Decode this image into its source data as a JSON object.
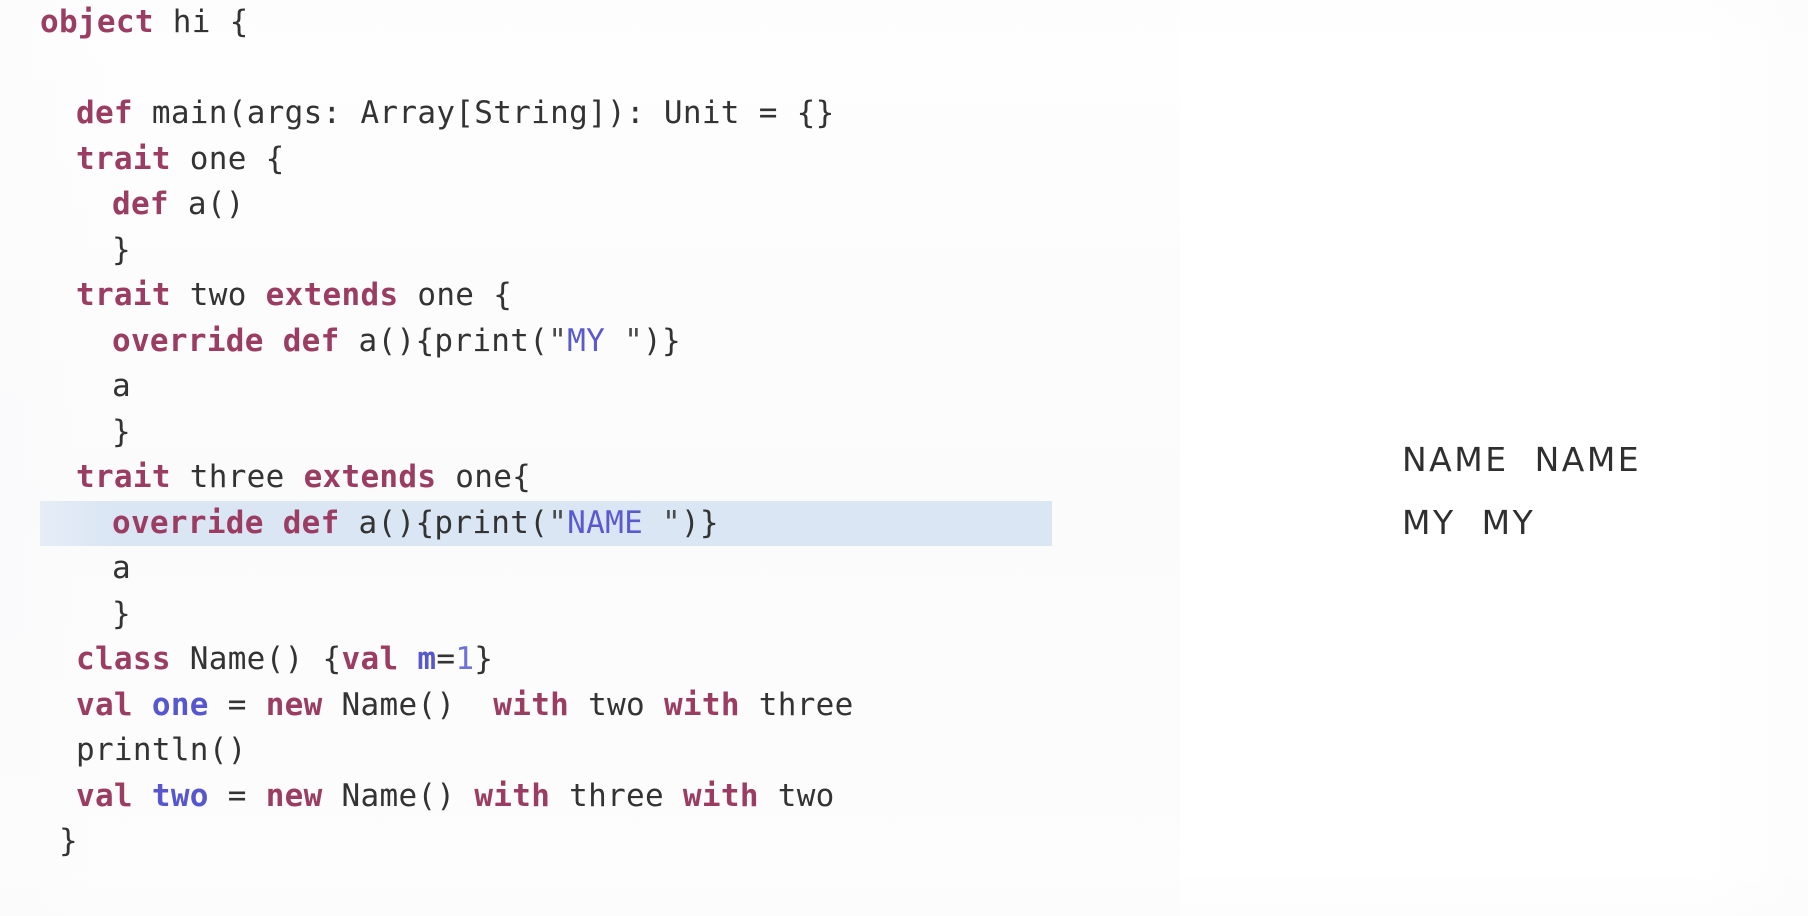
{
  "editor": {
    "language": "scala",
    "highlight_color": "#dbe6f4",
    "keyword_color": "#9b3d62",
    "string_color": "#5a5ad0",
    "number_color": "#6f6fd8",
    "text_color": "#2b2b2b",
    "background_color": "#fdfdfd",
    "highlighted_line_index": 9,
    "lines": [
      {
        "indent": 0,
        "highlighted": false,
        "tokens": [
          {
            "t": "object",
            "c": "kw"
          },
          {
            "t": " hi {",
            "c": "plain"
          }
        ]
      },
      {
        "indent": 0,
        "highlighted": false,
        "tokens": [
          {
            "t": "",
            "c": "plain"
          }
        ]
      },
      {
        "indent": 1,
        "highlighted": false,
        "tokens": [
          {
            "t": "def",
            "c": "kw"
          },
          {
            "t": " main(args: Array[String]): Unit = {}",
            "c": "plain"
          }
        ]
      },
      {
        "indent": 1,
        "highlighted": false,
        "tokens": [
          {
            "t": "trait",
            "c": "kw"
          },
          {
            "t": " one {",
            "c": "plain"
          }
        ]
      },
      {
        "indent": 2,
        "highlighted": false,
        "tokens": [
          {
            "t": "def",
            "c": "kw"
          },
          {
            "t": " a()",
            "c": "plain"
          }
        ]
      },
      {
        "indent": 2,
        "highlighted": false,
        "tokens": [
          {
            "t": "}",
            "c": "plain"
          }
        ]
      },
      {
        "indent": 1,
        "highlighted": false,
        "tokens": [
          {
            "t": "trait",
            "c": "kw"
          },
          {
            "t": " two ",
            "c": "plain"
          },
          {
            "t": "extends",
            "c": "kw"
          },
          {
            "t": " one {",
            "c": "plain"
          }
        ]
      },
      {
        "indent": 2,
        "highlighted": false,
        "tokens": [
          {
            "t": "override",
            "c": "kw"
          },
          {
            "t": " ",
            "c": "plain"
          },
          {
            "t": "def",
            "c": "kw"
          },
          {
            "t": " a(){print(",
            "c": "plain"
          },
          {
            "t": "\"",
            "c": "quo"
          },
          {
            "t": "MY ",
            "c": "str"
          },
          {
            "t": "\"",
            "c": "quo"
          },
          {
            "t": ")}",
            "c": "plain"
          }
        ]
      },
      {
        "indent": 2,
        "highlighted": false,
        "tokens": [
          {
            "t": "a",
            "c": "plain"
          }
        ]
      },
      {
        "indent": 2,
        "highlighted": false,
        "tokens": [
          {
            "t": "}",
            "c": "plain"
          }
        ]
      },
      {
        "indent": 1,
        "highlighted": false,
        "tokens": [
          {
            "t": "trait",
            "c": "kw"
          },
          {
            "t": " three ",
            "c": "plain"
          },
          {
            "t": "extends",
            "c": "kw"
          },
          {
            "t": " one{",
            "c": "plain"
          }
        ]
      },
      {
        "indent": 2,
        "highlighted": true,
        "tokens": [
          {
            "t": "override",
            "c": "kw"
          },
          {
            "t": " ",
            "c": "plain"
          },
          {
            "t": "def",
            "c": "kw"
          },
          {
            "t": " a(){print(",
            "c": "plain"
          },
          {
            "t": "\"",
            "c": "quo"
          },
          {
            "t": "NAME ",
            "c": "str"
          },
          {
            "t": "\"",
            "c": "quo"
          },
          {
            "t": ")}",
            "c": "plain"
          }
        ]
      },
      {
        "indent": 2,
        "highlighted": false,
        "tokens": [
          {
            "t": "a",
            "c": "plain"
          }
        ]
      },
      {
        "indent": 2,
        "highlighted": false,
        "tokens": [
          {
            "t": "}",
            "c": "plain"
          }
        ]
      },
      {
        "indent": 1,
        "highlighted": false,
        "tokens": [
          {
            "t": "class",
            "c": "kw"
          },
          {
            "t": " Name() {",
            "c": "plain"
          },
          {
            "t": "val",
            "c": "kw"
          },
          {
            "t": " ",
            "c": "plain"
          },
          {
            "t": "m",
            "c": "valname"
          },
          {
            "t": "=",
            "c": "plain"
          },
          {
            "t": "1",
            "c": "num"
          },
          {
            "t": "}",
            "c": "plain"
          }
        ]
      },
      {
        "indent": 1,
        "highlighted": false,
        "tokens": [
          {
            "t": "val",
            "c": "kw"
          },
          {
            "t": " ",
            "c": "plain"
          },
          {
            "t": "one",
            "c": "valname"
          },
          {
            "t": " = ",
            "c": "plain"
          },
          {
            "t": "new",
            "c": "kw"
          },
          {
            "t": " Name()  ",
            "c": "plain"
          },
          {
            "t": "with",
            "c": "kw"
          },
          {
            "t": " two ",
            "c": "plain"
          },
          {
            "t": "with",
            "c": "kw"
          },
          {
            "t": " three",
            "c": "plain"
          }
        ]
      },
      {
        "indent": 1,
        "highlighted": false,
        "tokens": [
          {
            "t": "println()",
            "c": "plain"
          }
        ]
      },
      {
        "indent": 1,
        "highlighted": false,
        "tokens": [
          {
            "t": "val",
            "c": "kw"
          },
          {
            "t": " ",
            "c": "plain"
          },
          {
            "t": "two",
            "c": "valname"
          },
          {
            "t": " = ",
            "c": "plain"
          },
          {
            "t": "new",
            "c": "kw"
          },
          {
            "t": " Name() ",
            "c": "plain"
          },
          {
            "t": "with",
            "c": "kw"
          },
          {
            "t": " three ",
            "c": "plain"
          },
          {
            "t": "with",
            "c": "kw"
          },
          {
            "t": " two",
            "c": "plain"
          }
        ]
      },
      {
        "indent": 0,
        "highlighted": false,
        "tokens": [
          {
            "t": " }",
            "c": "plain"
          }
        ]
      }
    ],
    "source_text": "object hi {\n\n  def main(args: Array[String]): Unit = {}\n  trait one {\n    def a()\n    }\n  trait two extends one {\n    override def a(){print(\"MY \")}\n    a\n    }\n  trait three extends one{\n    override def a(){print(\"NAME \")}\n    a\n    }\n  class Name() {val m=1}\n  val one = new Name()  with two with three\n  println()\n  val two = new Name() with three with two\n }"
  },
  "console": {
    "lines": [
      "NAME  NAME",
      "MY  MY"
    ]
  }
}
